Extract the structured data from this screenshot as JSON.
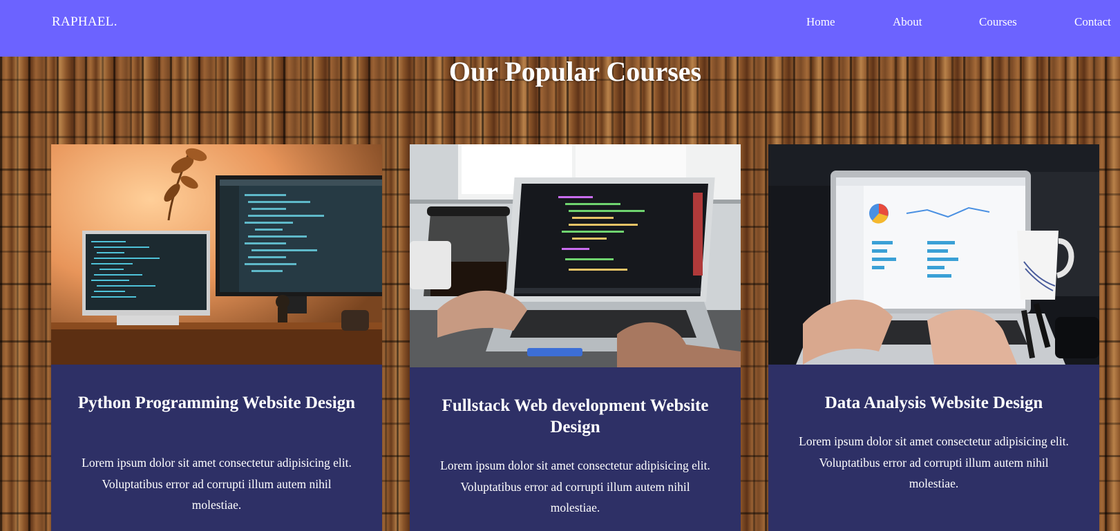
{
  "brand": "RAPHAEL.",
  "nav": {
    "links": [
      "Home",
      "About",
      "Courses",
      "Contact"
    ]
  },
  "section": {
    "title": "Our Popular Courses"
  },
  "courses": [
    {
      "title": "Python Programming Website Design",
      "description": "Lorem ipsum dolor sit amet consectetur adipisicing elit. Voluptatibus error ad corrupti illum autem nihil molestiae.",
      "image": "dual-monitor-code-photo"
    },
    {
      "title": "Fullstack Web development Website Design",
      "description": "Lorem ipsum dolor sit amet consectetur adipisicing elit. Voluptatibus error ad corrupti illum autem nihil molestiae.",
      "image": "laptop-code-photo"
    },
    {
      "title": "Data Analysis Website Design",
      "description": "Lorem ipsum dolor sit amet consectetur adipisicing elit. Voluptatibus error ad corrupti illum autem nihil molestiae.",
      "image": "laptop-dashboard-photo"
    }
  ],
  "colors": {
    "nav_bg": "#6c63ff",
    "card_bg": "#2e3066",
    "text": "#ffffff"
  }
}
